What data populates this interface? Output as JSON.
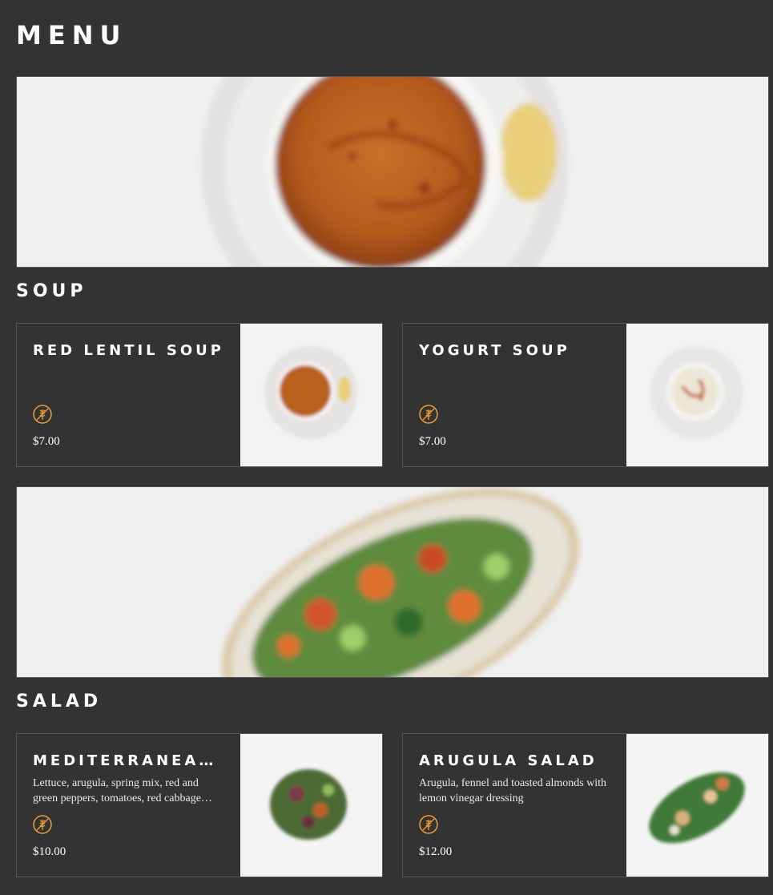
{
  "page": {
    "title": "MENU"
  },
  "sections": [
    {
      "title": "SOUP",
      "hero_image": "red-lentil-soup-bowl-photo",
      "items": [
        {
          "name": "RED LENTIL SOUP",
          "description": "",
          "badge_icon": "gluten-free-wheat-icon",
          "price": "$7.00",
          "image": "red-lentil-soup-photo"
        },
        {
          "name": "YOGURT SOUP",
          "description": "",
          "badge_icon": "gluten-free-wheat-icon",
          "price": "$7.00",
          "image": "yogurt-soup-photo"
        }
      ]
    },
    {
      "title": "SALAD",
      "hero_image": "chopped-salad-plate-photo",
      "items": [
        {
          "name": "MEDITERRANEAN …",
          "description": "Lettuce, arugula, spring mix, red and green peppers, tomatoes, red cabbage…",
          "badge_icon": "gluten-free-wheat-icon",
          "price": "$10.00",
          "image": "mediterranean-salad-photo"
        },
        {
          "name": "ARUGULA SALAD",
          "description": "Arugula, fennel and toasted almonds with lemon vinegar dressing",
          "badge_icon": "gluten-free-wheat-icon",
          "price": "$12.00",
          "image": "arugula-salad-photo"
        }
      ]
    }
  ],
  "colors": {
    "background": "#333333",
    "text": "#ffffff",
    "card_border": "#555555",
    "badge_accent": "#f0a030"
  }
}
